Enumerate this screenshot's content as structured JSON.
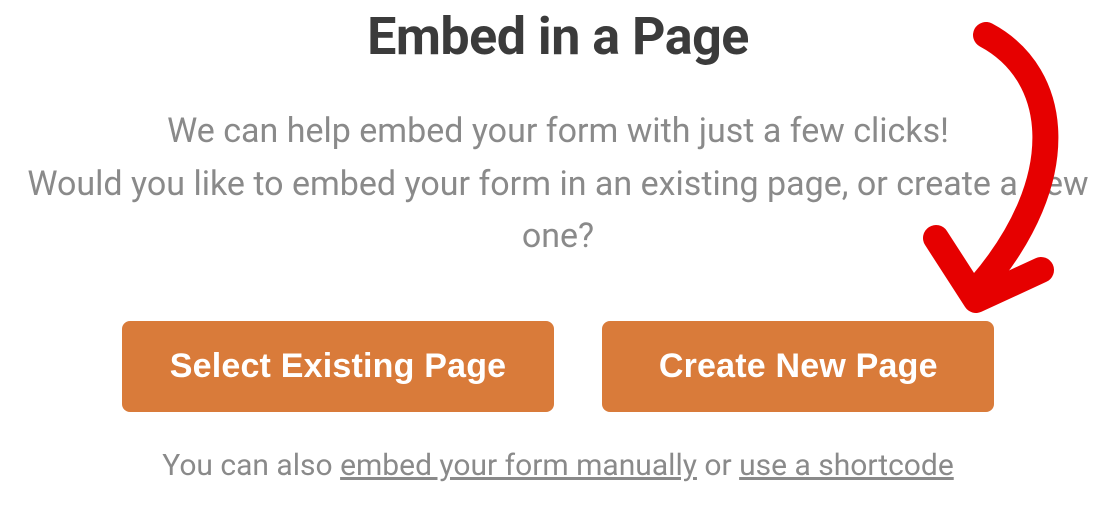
{
  "modal": {
    "title": "Embed in a Page",
    "description_line1": "We can help embed your form with just a few clicks!",
    "description_line2": "Would you like to embed your form in an existing page, or create a new one?",
    "buttons": {
      "select_existing": "Select Existing Page",
      "create_new": "Create New Page"
    },
    "footer": {
      "prefix": "You can also ",
      "link_manual": "embed your form manually",
      "middle": " or ",
      "link_shortcode": "use a shortcode"
    }
  },
  "annotation": {
    "arrow_color": "#e60000"
  }
}
